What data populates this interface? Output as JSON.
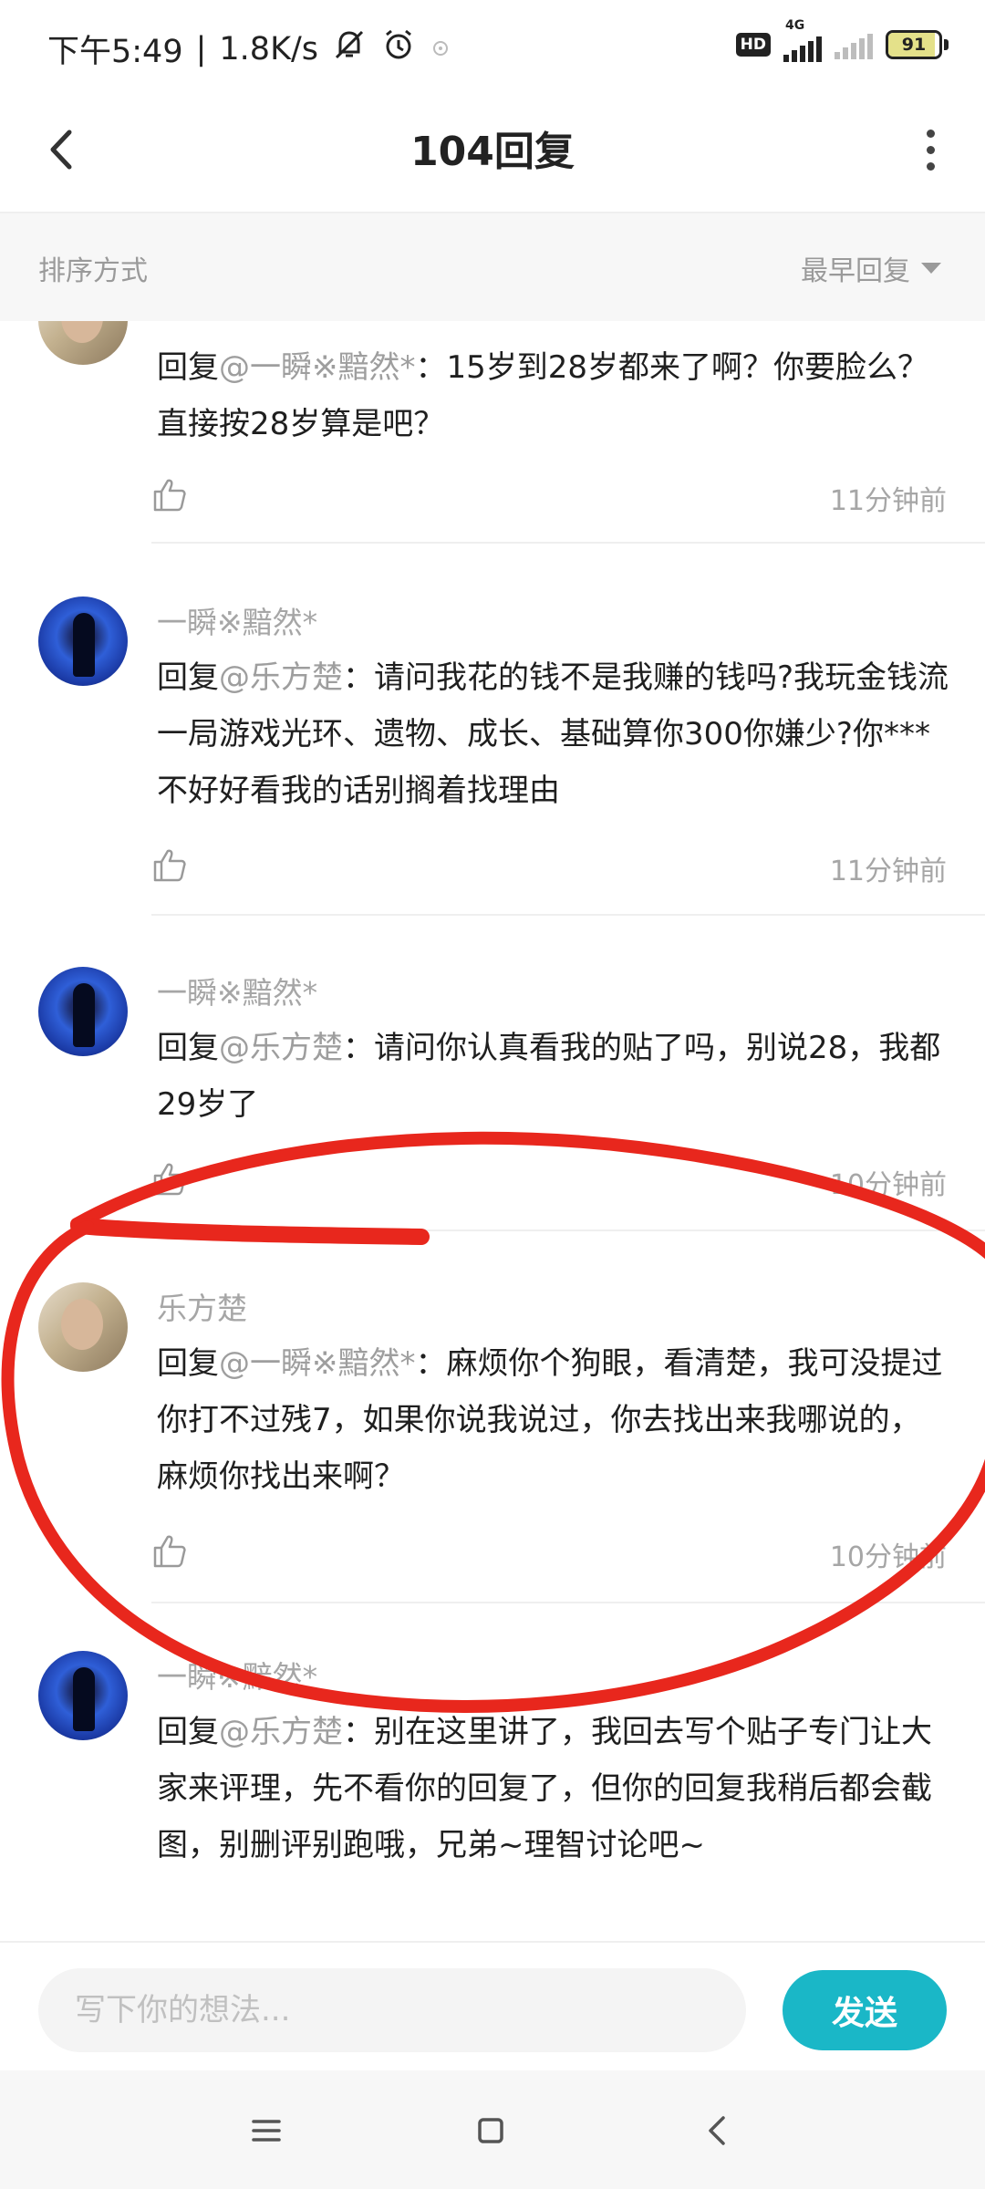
{
  "status_bar": {
    "time": "下午5:49",
    "speed": "1.8K/s",
    "hd_label": "HD",
    "network_label": "4G",
    "battery_level": "91"
  },
  "header": {
    "title": "104回复",
    "back_icon": "chevron-left-icon",
    "more_icon": "more-vertical-icon"
  },
  "sort": {
    "label": "排序方式",
    "selected": "最早回复"
  },
  "comments": [
    {
      "author": "",
      "avatar": "photo",
      "reply_prefix": "回复",
      "reply_to": "@一瞬※黯然*",
      "text": "：15岁到28岁都来了啊？你要脸么？直接按28岁算是吧？",
      "time": "11分钟前"
    },
    {
      "author": "一瞬※黯然*",
      "avatar": "blue",
      "reply_prefix": "回复",
      "reply_to": "@乐方楚",
      "text": "：请问我花的钱不是我赚的钱吗?我玩金钱流一局游戏光环、遗物、成长、基础算你300你嫌少?你***不好好看我的话别搁着找理由",
      "time": "11分钟前"
    },
    {
      "author": "一瞬※黯然*",
      "avatar": "blue",
      "reply_prefix": "回复",
      "reply_to": "@乐方楚",
      "text": "：请问你认真看我的贴了吗，别说28，我都29岁了",
      "time": "10分钟前"
    },
    {
      "author": "乐方楚",
      "avatar": "photo",
      "reply_prefix": "回复",
      "reply_to": "@一瞬※黯然*",
      "text": "：麻烦你个狗眼，看清楚，我可没提过你打不过残7，如果你说我说过，你去找出来我哪说的，麻烦你找出来啊？",
      "time": "10分钟前"
    },
    {
      "author": "一瞬※黯然*",
      "avatar": "blue",
      "reply_prefix": "回复",
      "reply_to": "@乐方楚",
      "text": "：别在这里讲了，我回去写个贴子专门让大家来评理，先不看你的回复了，但你的回复我稍后都会截图，别删评别跑哦，兄弟~理智讨论吧~",
      "time": ""
    }
  ],
  "input": {
    "placeholder": "写下你的想法...",
    "send_label": "发送"
  },
  "colors": {
    "accent": "#1ab7c7",
    "annotation_red": "#e8271d"
  }
}
